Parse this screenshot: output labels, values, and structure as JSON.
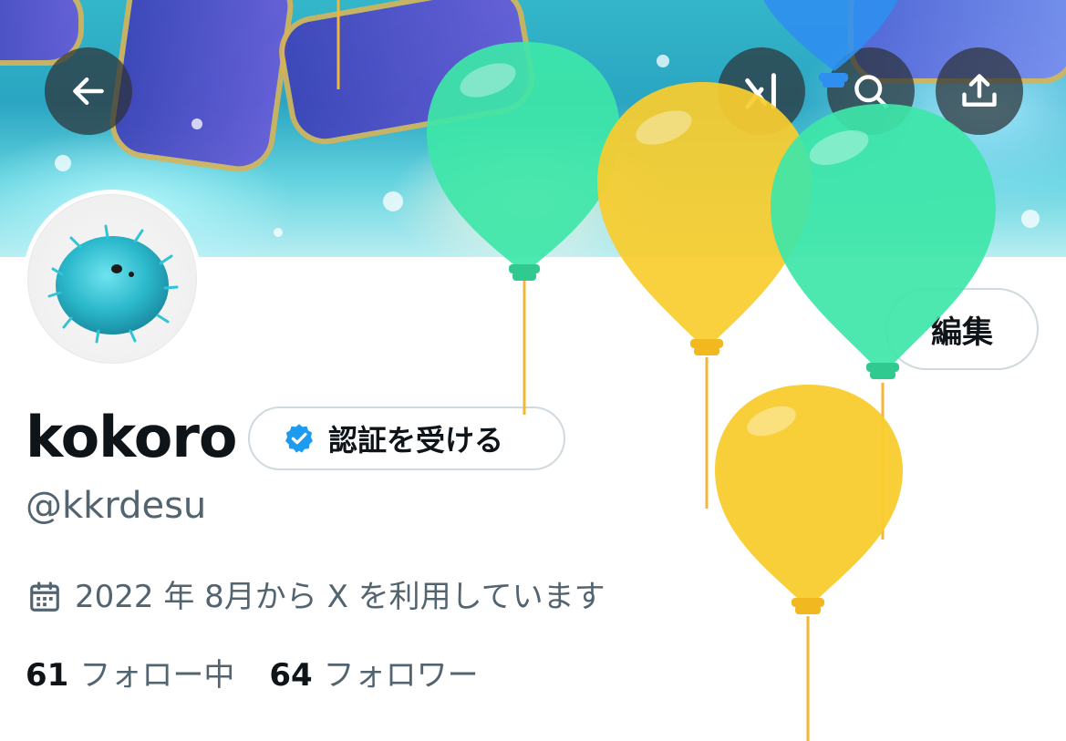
{
  "header": {
    "back_icon": "arrow-left-icon",
    "grok_icon": "grok-icon",
    "search_icon": "search-icon",
    "share_icon": "share-icon"
  },
  "profile": {
    "display_name": "kokoro",
    "handle": "@kkrdesu",
    "edit_label": "編集",
    "verify_label": "認証を受ける",
    "joined_text": "2022 年 8月から X を利用しています",
    "following_count": "61",
    "following_label": "フォロー中",
    "followers_count": "64",
    "followers_label": "フォロワー"
  },
  "colors": {
    "accent_blue": "#1d9bf0",
    "balloon_green": "#3ee6a8",
    "balloon_yellow": "#f9cc2e",
    "muted_text": "#536471"
  }
}
